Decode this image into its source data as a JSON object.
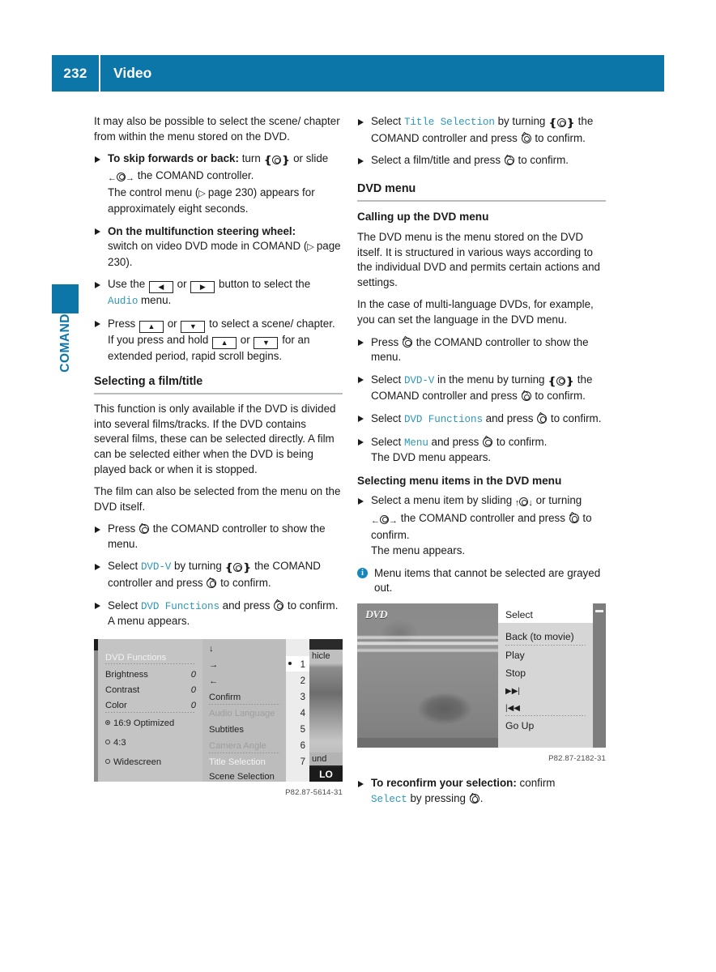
{
  "header": {
    "page_number": "232",
    "title": "Video",
    "bg_color": "#0d76a8"
  },
  "side_tab": {
    "label": "COMAND",
    "color": "#0d76a8"
  },
  "accent_color": "#2e97b8",
  "left_column": {
    "intro": "It may also be possible to select the scene/ chapter from within the menu stored on the DVD.",
    "bullets": [
      {
        "lead": "To skip forwards or back:",
        "text_1": "turn",
        "text_2": "or slide",
        "text_3": "the COMAND controller.",
        "sub": "The control menu (",
        "sub_ref": "page 230",
        "sub_2": ") appears for approximately eight seconds."
      },
      {
        "lead": "On the multifunction steering wheel:",
        "text_1": "switch on video DVD mode in COMAND (",
        "ref": "page 230",
        "text_2": ")."
      },
      {
        "text_1": "Use the",
        "text_2": "or",
        "text_3": "button to select the",
        "term": "Audio",
        "text_4": "menu."
      },
      {
        "text_1": "Press",
        "text_2": "or",
        "text_3": "to select a scene/ chapter.",
        "sub_1": "If you press and hold",
        "sub_2": "or",
        "sub_3": "for an extended period, rapid scroll begins."
      }
    ],
    "section_heading": "Selecting a film/title",
    "para_1": "This function is only available if the DVD is divided into several films/tracks. If the DVD contains several films, these can be selected directly. A film can be selected either when the DVD is being played back or when it is stopped.",
    "para_2": "The film can also be selected from the menu on the DVD itself.",
    "bullets_2": [
      {
        "text_1": "Press",
        "text_2": "the COMAND controller to show the menu."
      },
      {
        "text_1": "Select",
        "term": "DVD-V",
        "text_2": "by turning",
        "text_3": "the COMAND controller and press",
        "text_4": "to confirm."
      },
      {
        "text_1": "Select",
        "term": "DVD Functions",
        "text_2": "and press",
        "text_3": "to confirm.",
        "sub": "A menu appears."
      }
    ],
    "figure_caption": "P82.87-5614-31"
  },
  "right_column": {
    "bullets_top": [
      {
        "text_1": "Select",
        "term": "Title Selection",
        "text_2": "by turning",
        "text_3": "the COMAND controller and press",
        "text_4": "to confirm."
      },
      {
        "text_1": "Select a film/title and press",
        "text_2": "to confirm."
      }
    ],
    "section_heading": "DVD menu",
    "sub_heading_1": "Calling up the DVD menu",
    "para_1": "The DVD menu is the menu stored on the DVD itself. It is structured in various ways according to the individual DVD and permits certain actions and settings.",
    "para_2": "In the case of multi-language DVDs, for example, you can set the language in the DVD menu.",
    "bullets_mid": [
      {
        "text_1": "Press",
        "text_2": "the COMAND controller to show the menu."
      },
      {
        "text_1": "Select",
        "term": "DVD-V",
        "text_2": "in the menu by turning",
        "text_3": "the COMAND controller and press",
        "text_4": "to confirm."
      },
      {
        "text_1": "Select",
        "term": "DVD Functions",
        "text_2": "and press",
        "text_3": "to confirm."
      },
      {
        "text_1": "Select",
        "term": "Menu",
        "text_2": "and press",
        "text_3": "to confirm.",
        "sub": "The DVD menu appears."
      }
    ],
    "sub_heading_2": "Selecting menu items in the DVD menu",
    "bullet_slide": {
      "text_1": "Select a menu item by sliding",
      "text_2": "or turning",
      "text_3": "the COMAND controller and press",
      "text_4": "to confirm.",
      "sub": "The menu appears."
    },
    "info_note": "Menu items that cannot be selected are grayed out.",
    "figure_caption": "P82.87-2182-31",
    "bullet_bottom": {
      "lead": "To reconfirm your selection:",
      "text_1": "confirm",
      "term": "Select",
      "text_2": "by pressing",
      "text_3": "."
    }
  },
  "figure_dvd_functions": {
    "title": "DVD Functions",
    "settings": [
      {
        "label": "Brightness",
        "value": "0"
      },
      {
        "label": "Contrast",
        "value": "0"
      },
      {
        "label": "Color",
        "value": "0"
      }
    ],
    "aspect_options": [
      {
        "label": "16:9 Optimized",
        "selected": true
      },
      {
        "label": "4:3",
        "selected": false
      },
      {
        "label": "Widescreen",
        "selected": false
      }
    ],
    "menu_items": [
      {
        "label": "↓",
        "state": "normal"
      },
      {
        "label": "→",
        "state": "normal"
      },
      {
        "label": "←",
        "state": "normal"
      },
      {
        "label": "Confirm",
        "state": "normal"
      },
      {
        "label": "Audio Language",
        "state": "disabled"
      },
      {
        "label": "Subtitles",
        "state": "normal"
      },
      {
        "label": "Camera Angle",
        "state": "disabled"
      },
      {
        "label": "Title Selection",
        "state": "highlighted"
      },
      {
        "label": "Scene Selection",
        "state": "normal"
      }
    ],
    "numbers": [
      "1",
      "2",
      "3",
      "4",
      "5",
      "6",
      "7"
    ],
    "selected_number": "1",
    "video_label_top": "hicle",
    "video_label_bottom": "und",
    "video_badge": "LO"
  },
  "figure_dvd_menu": {
    "logo": "DVD",
    "selected_item": "Select",
    "items": [
      "Back (to movie)",
      "Play",
      "Stop",
      "▶▶|",
      "|◀◀",
      "Go Up"
    ]
  }
}
